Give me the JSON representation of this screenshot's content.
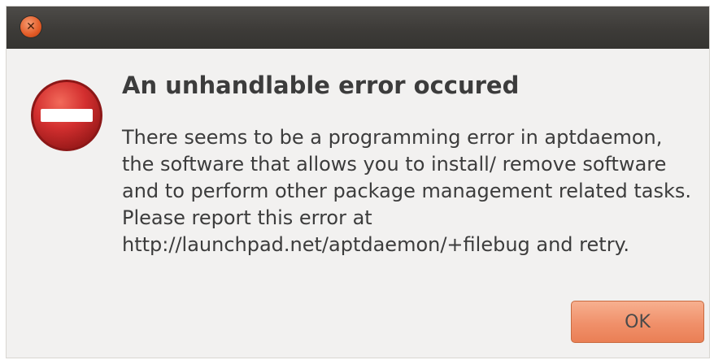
{
  "titlebar": {
    "close_icon": "close-icon"
  },
  "dialog": {
    "icon": "error-stop-icon",
    "heading": "An unhandlable error occured",
    "message": "There seems to be a programming error in aptdaemon, the software that allows you to install/ remove software and to perform other package management related tasks. Please report this error at http://launchpad.net/aptdaemon/+filebug and retry.",
    "ok_label": "OK"
  },
  "colors": {
    "titlebar": "#3d3b38",
    "dialog_background": "#f2f1f0",
    "accent_orange": "#ea7f55",
    "error_red": "#cc2a2a"
  }
}
